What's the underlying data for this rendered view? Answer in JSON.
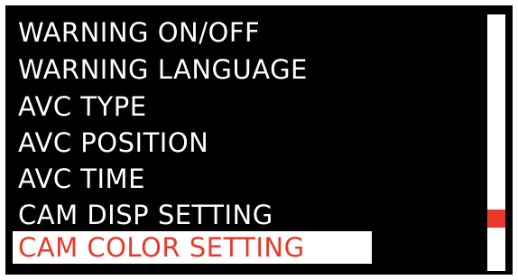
{
  "menu": {
    "items": [
      {
        "label": "WARNING ON/OFF",
        "selected": false
      },
      {
        "label": "WARNING LANGUAGE",
        "selected": false
      },
      {
        "label": "AVC TYPE",
        "selected": false
      },
      {
        "label": "AVC POSITION",
        "selected": false
      },
      {
        "label": "AVC TIME",
        "selected": false
      },
      {
        "label": "CAM DISP SETTING",
        "selected": false
      },
      {
        "label": "CAM COLOR SETTING",
        "selected": true
      }
    ]
  },
  "scrollbar": {
    "position_fraction": 0.82
  },
  "colors": {
    "background": "#000000",
    "text": "#ffffff",
    "selected_background": "#ffffff",
    "selected_text": "#e8392a",
    "scroll_thumb": "#e8392a"
  }
}
